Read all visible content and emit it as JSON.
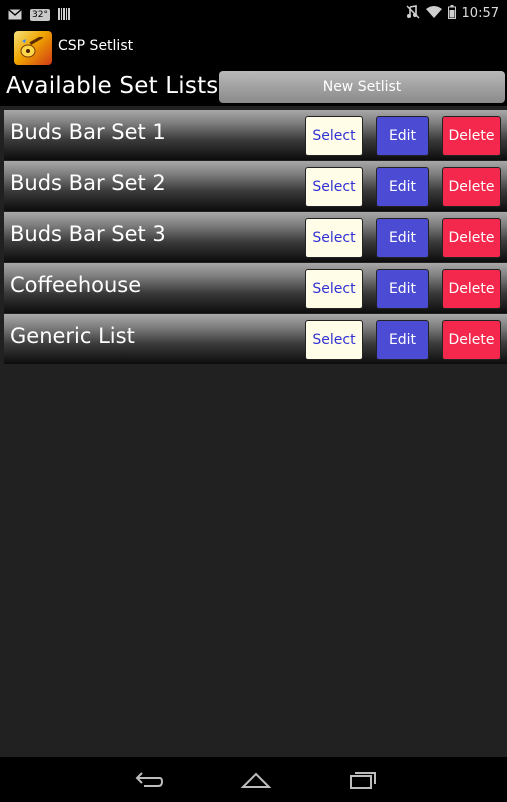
{
  "status_bar": {
    "time": "10:57",
    "temperature": "32°",
    "left_icons": [
      "mail-icon",
      "weather-icon",
      "barcode-icon"
    ],
    "right_icons": [
      "mute-icon",
      "wifi-icon",
      "battery-icon"
    ]
  },
  "action_bar": {
    "app_title": "CSP Setlist",
    "app_icon": "guitar-icon"
  },
  "header": {
    "title": "Available Set Lists",
    "new_button_label": "New Setlist"
  },
  "setlists": [
    {
      "name": "Buds Bar Set 1",
      "select_label": "Select",
      "edit_label": "Edit",
      "delete_label": "Delete"
    },
    {
      "name": "Buds Bar Set 2",
      "select_label": "Select",
      "edit_label": "Edit",
      "delete_label": "Delete"
    },
    {
      "name": "Buds Bar Set 3",
      "select_label": "Select",
      "edit_label": "Edit",
      "delete_label": "Delete"
    },
    {
      "name": "Coffeehouse",
      "select_label": "Select",
      "edit_label": "Edit",
      "delete_label": "Delete"
    },
    {
      "name": "Generic List",
      "select_label": "Select",
      "edit_label": "Edit",
      "delete_label": "Delete"
    }
  ],
  "nav_bar": {
    "buttons": [
      "back-icon",
      "home-icon",
      "recents-icon"
    ]
  },
  "colors": {
    "select_bg": "#fffde8",
    "select_text": "#3132d4",
    "edit_bg": "#4b4bd4",
    "delete_bg": "#f3284c",
    "background": "#212121"
  }
}
